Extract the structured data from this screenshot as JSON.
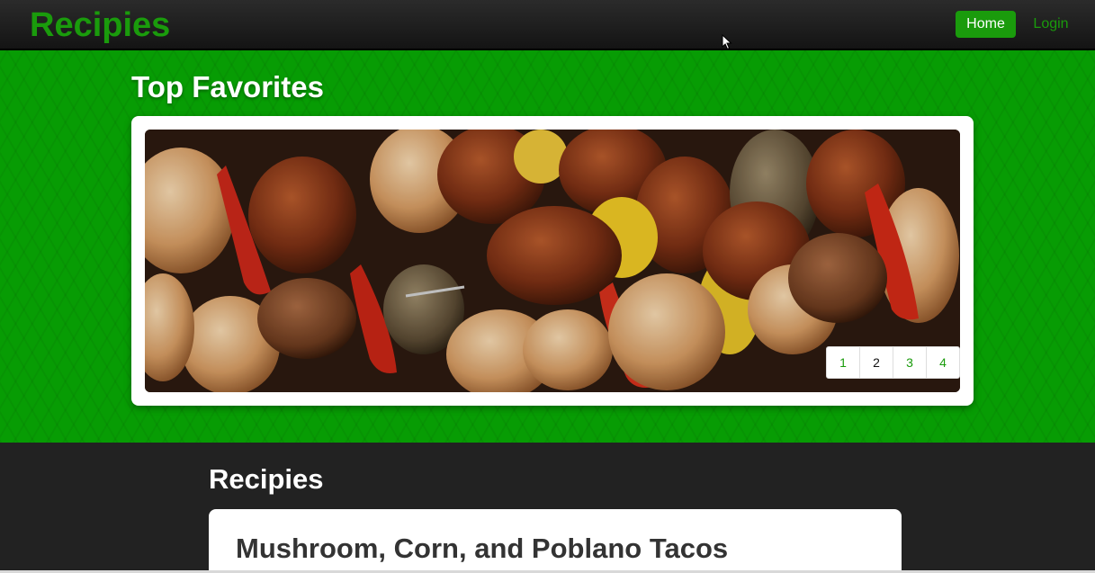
{
  "navbar": {
    "brand": "Recipies",
    "home_label": "Home",
    "login_label": "Login"
  },
  "hero": {
    "title": "Top Favorites",
    "slide_image": "grilled-kebabs-photo",
    "pager": [
      {
        "label": "1",
        "active": false
      },
      {
        "label": "2",
        "active": true
      },
      {
        "label": "3",
        "active": false
      },
      {
        "label": "4",
        "active": false
      }
    ]
  },
  "recipes": {
    "heading": "Recipies",
    "items": [
      {
        "title": "Mushroom, Corn, and Poblano Tacos"
      }
    ]
  },
  "colors": {
    "accent": "#1a9b0c",
    "hero_bg": "#079c04",
    "navbar_bg": "#1a1a1a",
    "page_bg": "#222222"
  }
}
